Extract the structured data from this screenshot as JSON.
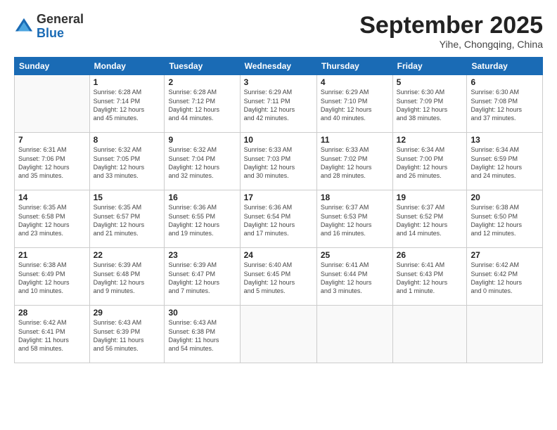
{
  "logo": {
    "general": "General",
    "blue": "Blue"
  },
  "header": {
    "month": "September 2025",
    "location": "Yihe, Chongqing, China"
  },
  "weekdays": [
    "Sunday",
    "Monday",
    "Tuesday",
    "Wednesday",
    "Thursday",
    "Friday",
    "Saturday"
  ],
  "weeks": [
    [
      {
        "day": "",
        "info": ""
      },
      {
        "day": "1",
        "info": "Sunrise: 6:28 AM\nSunset: 7:14 PM\nDaylight: 12 hours\nand 45 minutes."
      },
      {
        "day": "2",
        "info": "Sunrise: 6:28 AM\nSunset: 7:12 PM\nDaylight: 12 hours\nand 44 minutes."
      },
      {
        "day": "3",
        "info": "Sunrise: 6:29 AM\nSunset: 7:11 PM\nDaylight: 12 hours\nand 42 minutes."
      },
      {
        "day": "4",
        "info": "Sunrise: 6:29 AM\nSunset: 7:10 PM\nDaylight: 12 hours\nand 40 minutes."
      },
      {
        "day": "5",
        "info": "Sunrise: 6:30 AM\nSunset: 7:09 PM\nDaylight: 12 hours\nand 38 minutes."
      },
      {
        "day": "6",
        "info": "Sunrise: 6:30 AM\nSunset: 7:08 PM\nDaylight: 12 hours\nand 37 minutes."
      }
    ],
    [
      {
        "day": "7",
        "info": "Sunrise: 6:31 AM\nSunset: 7:06 PM\nDaylight: 12 hours\nand 35 minutes."
      },
      {
        "day": "8",
        "info": "Sunrise: 6:32 AM\nSunset: 7:05 PM\nDaylight: 12 hours\nand 33 minutes."
      },
      {
        "day": "9",
        "info": "Sunrise: 6:32 AM\nSunset: 7:04 PM\nDaylight: 12 hours\nand 32 minutes."
      },
      {
        "day": "10",
        "info": "Sunrise: 6:33 AM\nSunset: 7:03 PM\nDaylight: 12 hours\nand 30 minutes."
      },
      {
        "day": "11",
        "info": "Sunrise: 6:33 AM\nSunset: 7:02 PM\nDaylight: 12 hours\nand 28 minutes."
      },
      {
        "day": "12",
        "info": "Sunrise: 6:34 AM\nSunset: 7:00 PM\nDaylight: 12 hours\nand 26 minutes."
      },
      {
        "day": "13",
        "info": "Sunrise: 6:34 AM\nSunset: 6:59 PM\nDaylight: 12 hours\nand 24 minutes."
      }
    ],
    [
      {
        "day": "14",
        "info": "Sunrise: 6:35 AM\nSunset: 6:58 PM\nDaylight: 12 hours\nand 23 minutes."
      },
      {
        "day": "15",
        "info": "Sunrise: 6:35 AM\nSunset: 6:57 PM\nDaylight: 12 hours\nand 21 minutes."
      },
      {
        "day": "16",
        "info": "Sunrise: 6:36 AM\nSunset: 6:55 PM\nDaylight: 12 hours\nand 19 minutes."
      },
      {
        "day": "17",
        "info": "Sunrise: 6:36 AM\nSunset: 6:54 PM\nDaylight: 12 hours\nand 17 minutes."
      },
      {
        "day": "18",
        "info": "Sunrise: 6:37 AM\nSunset: 6:53 PM\nDaylight: 12 hours\nand 16 minutes."
      },
      {
        "day": "19",
        "info": "Sunrise: 6:37 AM\nSunset: 6:52 PM\nDaylight: 12 hours\nand 14 minutes."
      },
      {
        "day": "20",
        "info": "Sunrise: 6:38 AM\nSunset: 6:50 PM\nDaylight: 12 hours\nand 12 minutes."
      }
    ],
    [
      {
        "day": "21",
        "info": "Sunrise: 6:38 AM\nSunset: 6:49 PM\nDaylight: 12 hours\nand 10 minutes."
      },
      {
        "day": "22",
        "info": "Sunrise: 6:39 AM\nSunset: 6:48 PM\nDaylight: 12 hours\nand 9 minutes."
      },
      {
        "day": "23",
        "info": "Sunrise: 6:39 AM\nSunset: 6:47 PM\nDaylight: 12 hours\nand 7 minutes."
      },
      {
        "day": "24",
        "info": "Sunrise: 6:40 AM\nSunset: 6:45 PM\nDaylight: 12 hours\nand 5 minutes."
      },
      {
        "day": "25",
        "info": "Sunrise: 6:41 AM\nSunset: 6:44 PM\nDaylight: 12 hours\nand 3 minutes."
      },
      {
        "day": "26",
        "info": "Sunrise: 6:41 AM\nSunset: 6:43 PM\nDaylight: 12 hours\nand 1 minute."
      },
      {
        "day": "27",
        "info": "Sunrise: 6:42 AM\nSunset: 6:42 PM\nDaylight: 12 hours\nand 0 minutes."
      }
    ],
    [
      {
        "day": "28",
        "info": "Sunrise: 6:42 AM\nSunset: 6:41 PM\nDaylight: 11 hours\nand 58 minutes."
      },
      {
        "day": "29",
        "info": "Sunrise: 6:43 AM\nSunset: 6:39 PM\nDaylight: 11 hours\nand 56 minutes."
      },
      {
        "day": "30",
        "info": "Sunrise: 6:43 AM\nSunset: 6:38 PM\nDaylight: 11 hours\nand 54 minutes."
      },
      {
        "day": "",
        "info": ""
      },
      {
        "day": "",
        "info": ""
      },
      {
        "day": "",
        "info": ""
      },
      {
        "day": "",
        "info": ""
      }
    ]
  ]
}
